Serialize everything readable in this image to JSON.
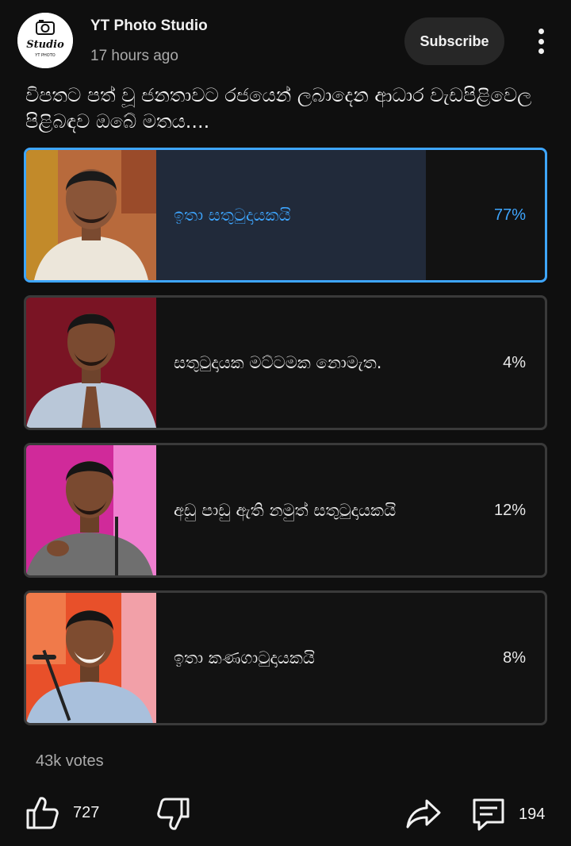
{
  "post": {
    "channel_name": "YT Photo Studio",
    "time_ago": "17 hours ago",
    "subscribe_label": "Subscribe",
    "avatar_text_top": "Studio",
    "avatar_text_bottom": "YT PHOTO",
    "question": "විපතට පත් වූ ජනතාවට රජයෙන් ලබාදෙන ආධාර වැඩපිළිවෙල පිළිබඳව ඔබේ මතය...."
  },
  "poll": {
    "options": [
      {
        "label": "ඉතා සතුටුදායකයි",
        "percent_text": "77%",
        "percent": 77,
        "selected": true
      },
      {
        "label": "සතුටුදායක මට්ටමක නොමැත.",
        "percent_text": "4%",
        "percent": 4,
        "selected": false
      },
      {
        "label": "අඩු පාඩු ඇති නමුත් සතුටුදායකයි",
        "percent_text": "12%",
        "percent": 12,
        "selected": false
      },
      {
        "label": "ඉතා කණගාටුදායකයි",
        "percent_text": "8%",
        "percent": 8,
        "selected": false
      }
    ],
    "votes": "43k votes"
  },
  "actions": {
    "likes": "727",
    "comments": "194"
  },
  "colors": {
    "background": "#0f0f0f",
    "accent": "#3ea6ff",
    "option_border": "#3a3a3a",
    "subscribe_bg": "#272727"
  }
}
